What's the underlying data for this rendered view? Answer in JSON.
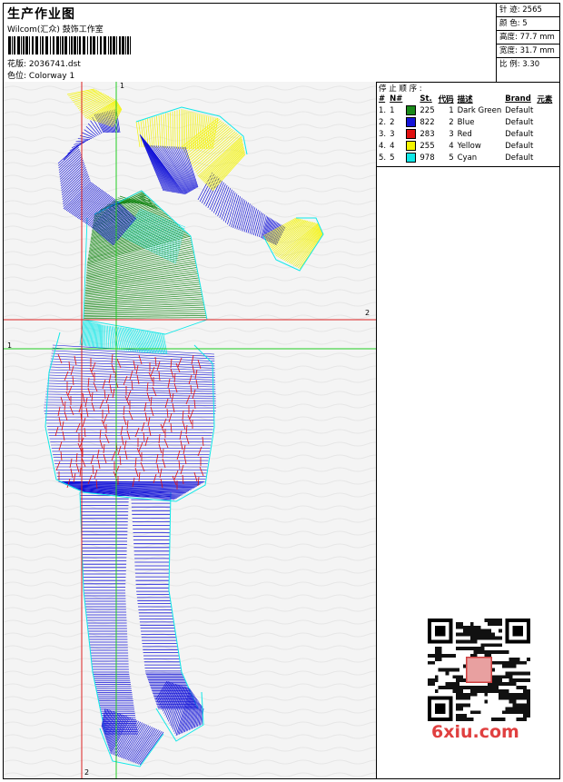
{
  "header": {
    "title": "生产作业图",
    "company": "Wilcom(汇众) 鼓饰工作室",
    "design_label": "花版:",
    "design_file": "2036741.dst",
    "color_label": "色位:",
    "colorway": "Colorway 1"
  },
  "stats": {
    "stitches": "针 迹: 2565",
    "colors": "颜 色: 5",
    "height": "高度: 77.7 mm",
    "width": "宽度: 31.7 mm",
    "scale": "比 例: 3.30"
  },
  "stop_sequence": {
    "title": "停 止 顺 序 :",
    "columns": [
      "#",
      "N#",
      "St.",
      "代码",
      "描述",
      "Brand",
      "元素"
    ],
    "rows": [
      {
        "idx": "1.",
        "n": "1",
        "color": "#1a8a1a",
        "st": "225",
        "code": "1",
        "desc": "Dark Green",
        "brand": "Default"
      },
      {
        "idx": "2.",
        "n": "2",
        "color": "#1414d8",
        "st": "822",
        "code": "2",
        "desc": "Blue",
        "brand": "Default"
      },
      {
        "idx": "3.",
        "n": "3",
        "color": "#e01010",
        "st": "283",
        "code": "3",
        "desc": "Red",
        "brand": "Default"
      },
      {
        "idx": "4.",
        "n": "4",
        "color": "#f4f400",
        "st": "255",
        "code": "4",
        "desc": "Yellow",
        "brand": "Default"
      },
      {
        "idx": "5.",
        "n": "5",
        "color": "#10e8e8",
        "st": "978",
        "code": "5",
        "desc": "Cyan",
        "brand": "Default"
      }
    ]
  },
  "axes": {
    "top_vertical": "1",
    "left_horizontal": "1",
    "right_horizontal": "2",
    "bottom_vertical": "2"
  },
  "watermark": "6xiu.com",
  "thread_colors": {
    "green": "#1a8a1a",
    "blue": "#1414d8",
    "red": "#e01010",
    "yellow": "#f4f400",
    "cyan": "#10e8e8"
  }
}
